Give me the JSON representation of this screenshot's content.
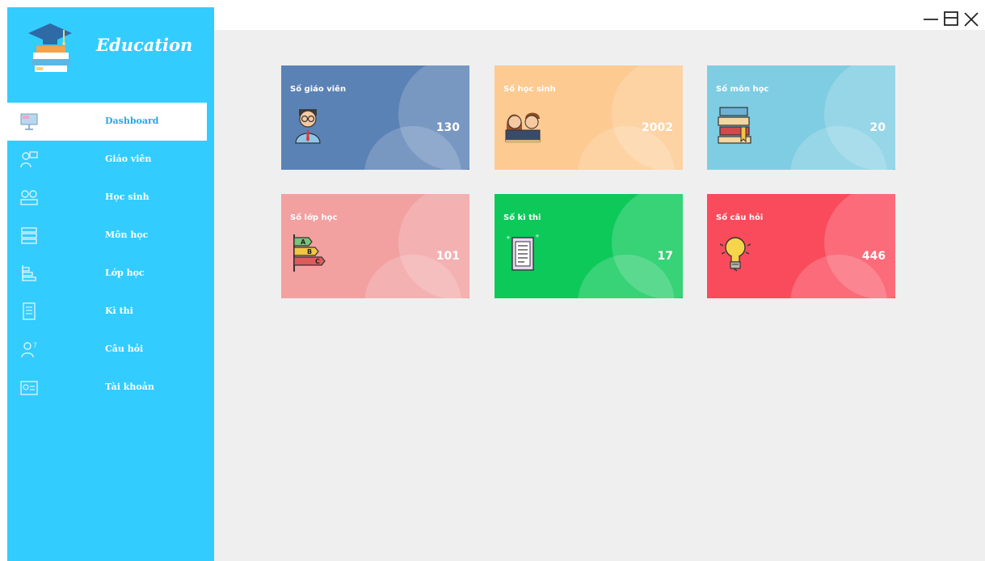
{
  "app": {
    "title": "Education"
  },
  "window_controls": {
    "minimize_icon": "minimize-icon",
    "restore_icon": "restore-icon",
    "close_icon": "close-icon"
  },
  "sidebar": {
    "items": [
      {
        "label": "Dashboard",
        "icon": "presentation-board-icon",
        "active": true
      },
      {
        "label": "Giáo viên",
        "icon": "teacher-icon",
        "active": false
      },
      {
        "label": "Học sinh",
        "icon": "students-icon",
        "active": false
      },
      {
        "label": "Môn học",
        "icon": "books-icon",
        "active": false
      },
      {
        "label": "Lớp học",
        "icon": "class-chart-icon",
        "active": false
      },
      {
        "label": "Kì thi",
        "icon": "exam-paper-icon",
        "active": false
      },
      {
        "label": "Câu hỏi",
        "icon": "question-person-icon",
        "active": false
      },
      {
        "label": "Tài khoản",
        "icon": "account-card-icon",
        "active": false
      }
    ]
  },
  "cards": [
    {
      "title": "Số giáo viên",
      "value": "130",
      "color": "#5b82b5",
      "icon": "teacher-avatar-icon"
    },
    {
      "title": "Số học sinh",
      "value": "2002",
      "color": "#fdca91",
      "icon": "students-avatar-icon"
    },
    {
      "title": "Số môn học",
      "value": "20",
      "color": "#7fcde2",
      "icon": "books-stack-icon"
    },
    {
      "title": "Số lớp học",
      "value": "101",
      "color": "#f2a0a0",
      "icon": "grade-levels-icon"
    },
    {
      "title": "Số kì thi",
      "value": "17",
      "color": "#0dc95a",
      "icon": "exam-document-icon"
    },
    {
      "title": "Số câu hỏi",
      "value": "446",
      "color": "#fa4b5c",
      "icon": "lightbulb-icon"
    }
  ],
  "colors": {
    "sidebar": "#33ccff",
    "main_bg": "#efefef",
    "active_label": "#2aa6e6"
  }
}
